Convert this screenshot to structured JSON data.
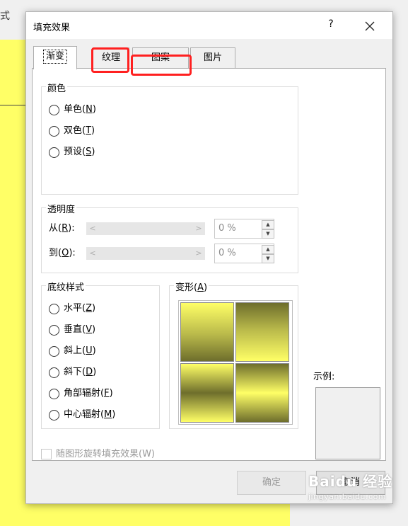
{
  "background": {
    "glyph": "式",
    "yellow": "#ffff66"
  },
  "dialog": {
    "title": "填充效果",
    "help": "?",
    "tabs": [
      {
        "label": "渐变",
        "active": true
      },
      {
        "label": "纹理",
        "highlighted": true
      },
      {
        "label": "图案",
        "highlighted": true
      },
      {
        "label": "图片"
      }
    ]
  },
  "colors": {
    "legend": "颜色",
    "options": [
      {
        "text": "单色(",
        "key": "N",
        "end": ")"
      },
      {
        "text": "双色(",
        "key": "T",
        "end": ")"
      },
      {
        "text": "预设(",
        "key": "S",
        "end": ")"
      }
    ]
  },
  "transparency": {
    "legend": "透明度",
    "from": {
      "text": "从(",
      "key": "R",
      "end": "):",
      "value": "0 %"
    },
    "to": {
      "text": "到(",
      "key": "O",
      "end": "):",
      "value": "0 %"
    }
  },
  "shading": {
    "legend": "底纹样式",
    "options": [
      {
        "text": "水平(",
        "key": "Z",
        "end": ")"
      },
      {
        "text": "垂直(",
        "key": "V",
        "end": ")"
      },
      {
        "text": "斜上(",
        "key": "U",
        "end": ")"
      },
      {
        "text": "斜下(",
        "key": "D",
        "end": ")"
      },
      {
        "text": "角部辐射(",
        "key": "F",
        "end": ")"
      },
      {
        "text": "中心辐射(",
        "key": "M",
        "end": ")"
      }
    ]
  },
  "variants": {
    "legend_text": "变形(",
    "key": "A",
    "end": ")"
  },
  "sample": {
    "label": "示例:"
  },
  "rotate_checkbox": {
    "label": "随图形旋转填充效果(W)"
  },
  "buttons": {
    "ok": "确定",
    "cancel": "取消"
  },
  "watermark": {
    "main": "Baidu 经验",
    "sub": "jingyan.baidu.com"
  }
}
